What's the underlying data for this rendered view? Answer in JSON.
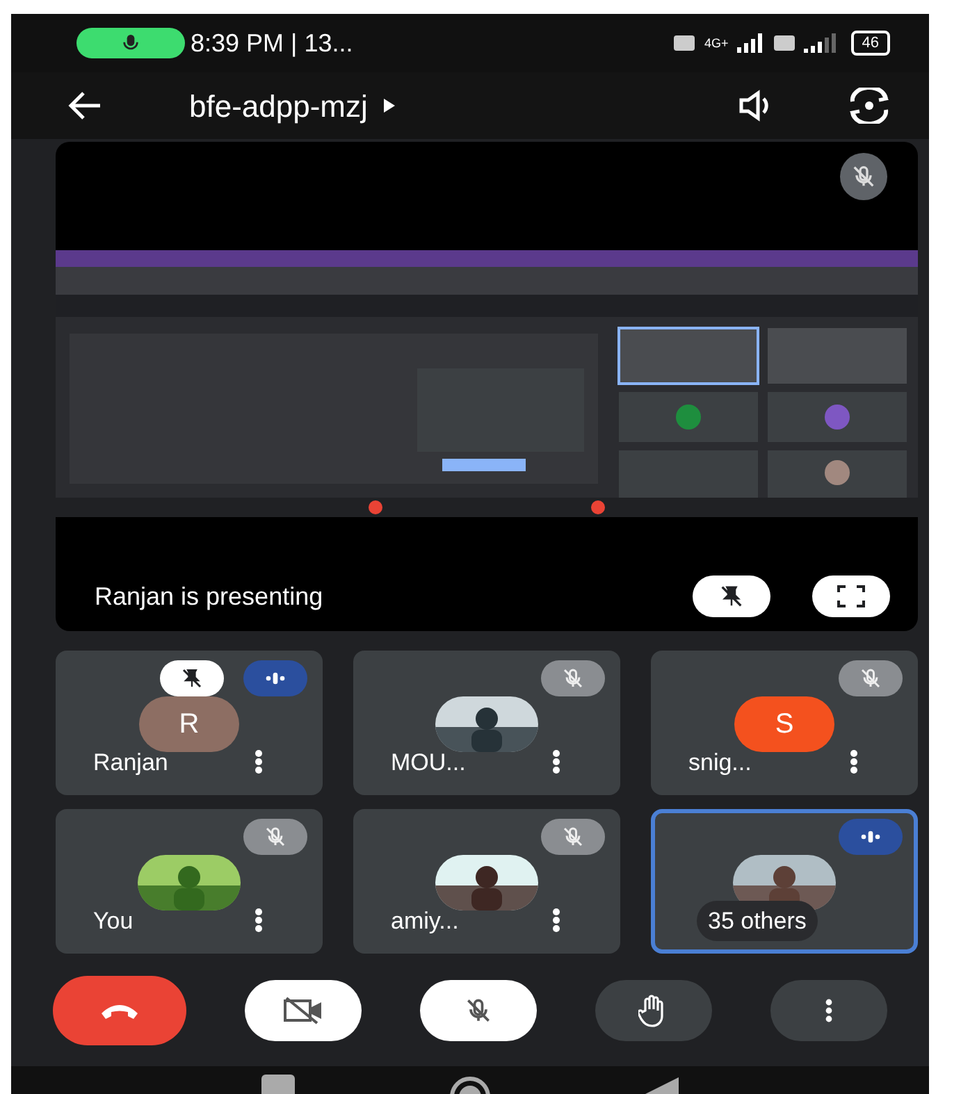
{
  "status_bar": {
    "time": "8:39 PM | 13...",
    "network": "4G+",
    "battery": "46"
  },
  "header": {
    "meeting_code": "bfe-adpp-mzj"
  },
  "presentation": {
    "caption": "Ranjan is presenting",
    "muted": true
  },
  "tiles": [
    {
      "name": "Ranjan",
      "kind": "letter",
      "letter": "R",
      "color": "#8d6e63",
      "muted": false,
      "speaking": true,
      "pinned": true,
      "highlighted": false
    },
    {
      "name": "MOU...",
      "kind": "picture",
      "muted": true,
      "speaking": false,
      "pinned": false,
      "highlighted": false
    },
    {
      "name": "snig...",
      "kind": "letter",
      "letter": "S",
      "color": "#f4511e",
      "muted": true,
      "speaking": false,
      "pinned": false,
      "highlighted": false
    },
    {
      "name": "You",
      "kind": "picture",
      "muted": true,
      "speaking": false,
      "pinned": false,
      "highlighted": false
    },
    {
      "name": "amiy...",
      "kind": "picture",
      "muted": true,
      "speaking": false,
      "pinned": false,
      "highlighted": false
    },
    {
      "name": "35 others",
      "kind": "picture",
      "muted": false,
      "speaking": true,
      "pinned": false,
      "highlighted": true
    }
  ],
  "controls": {
    "camera_on": false,
    "mic_on": false
  }
}
